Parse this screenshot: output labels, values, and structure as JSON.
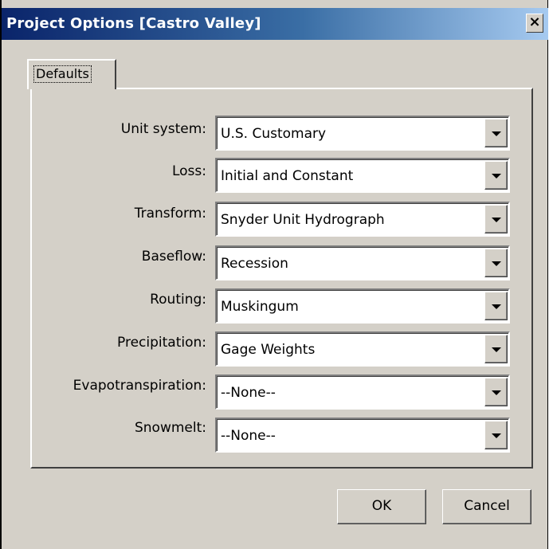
{
  "window": {
    "title": "Project Options [Castro Valley]",
    "close_label": "×"
  },
  "tabs": [
    {
      "label": "Defaults"
    }
  ],
  "fields": [
    {
      "label": "Unit system:",
      "value": "U.S. Customary"
    },
    {
      "label": "Loss:",
      "value": "Initial and Constant"
    },
    {
      "label": "Transform:",
      "value": "Snyder Unit Hydrograph"
    },
    {
      "label": "Baseflow:",
      "value": "Recession"
    },
    {
      "label": "Routing:",
      "value": "Muskingum"
    },
    {
      "label": "Precipitation:",
      "value": "Gage Weights"
    },
    {
      "label": "Evapotranspiration:",
      "value": "--None--"
    },
    {
      "label": "Snowmelt:",
      "value": "--None--"
    }
  ],
  "buttons": {
    "ok": "OK",
    "cancel": "Cancel"
  },
  "icons": {
    "close": "close-icon",
    "dropdown": "chevron-down-icon"
  }
}
